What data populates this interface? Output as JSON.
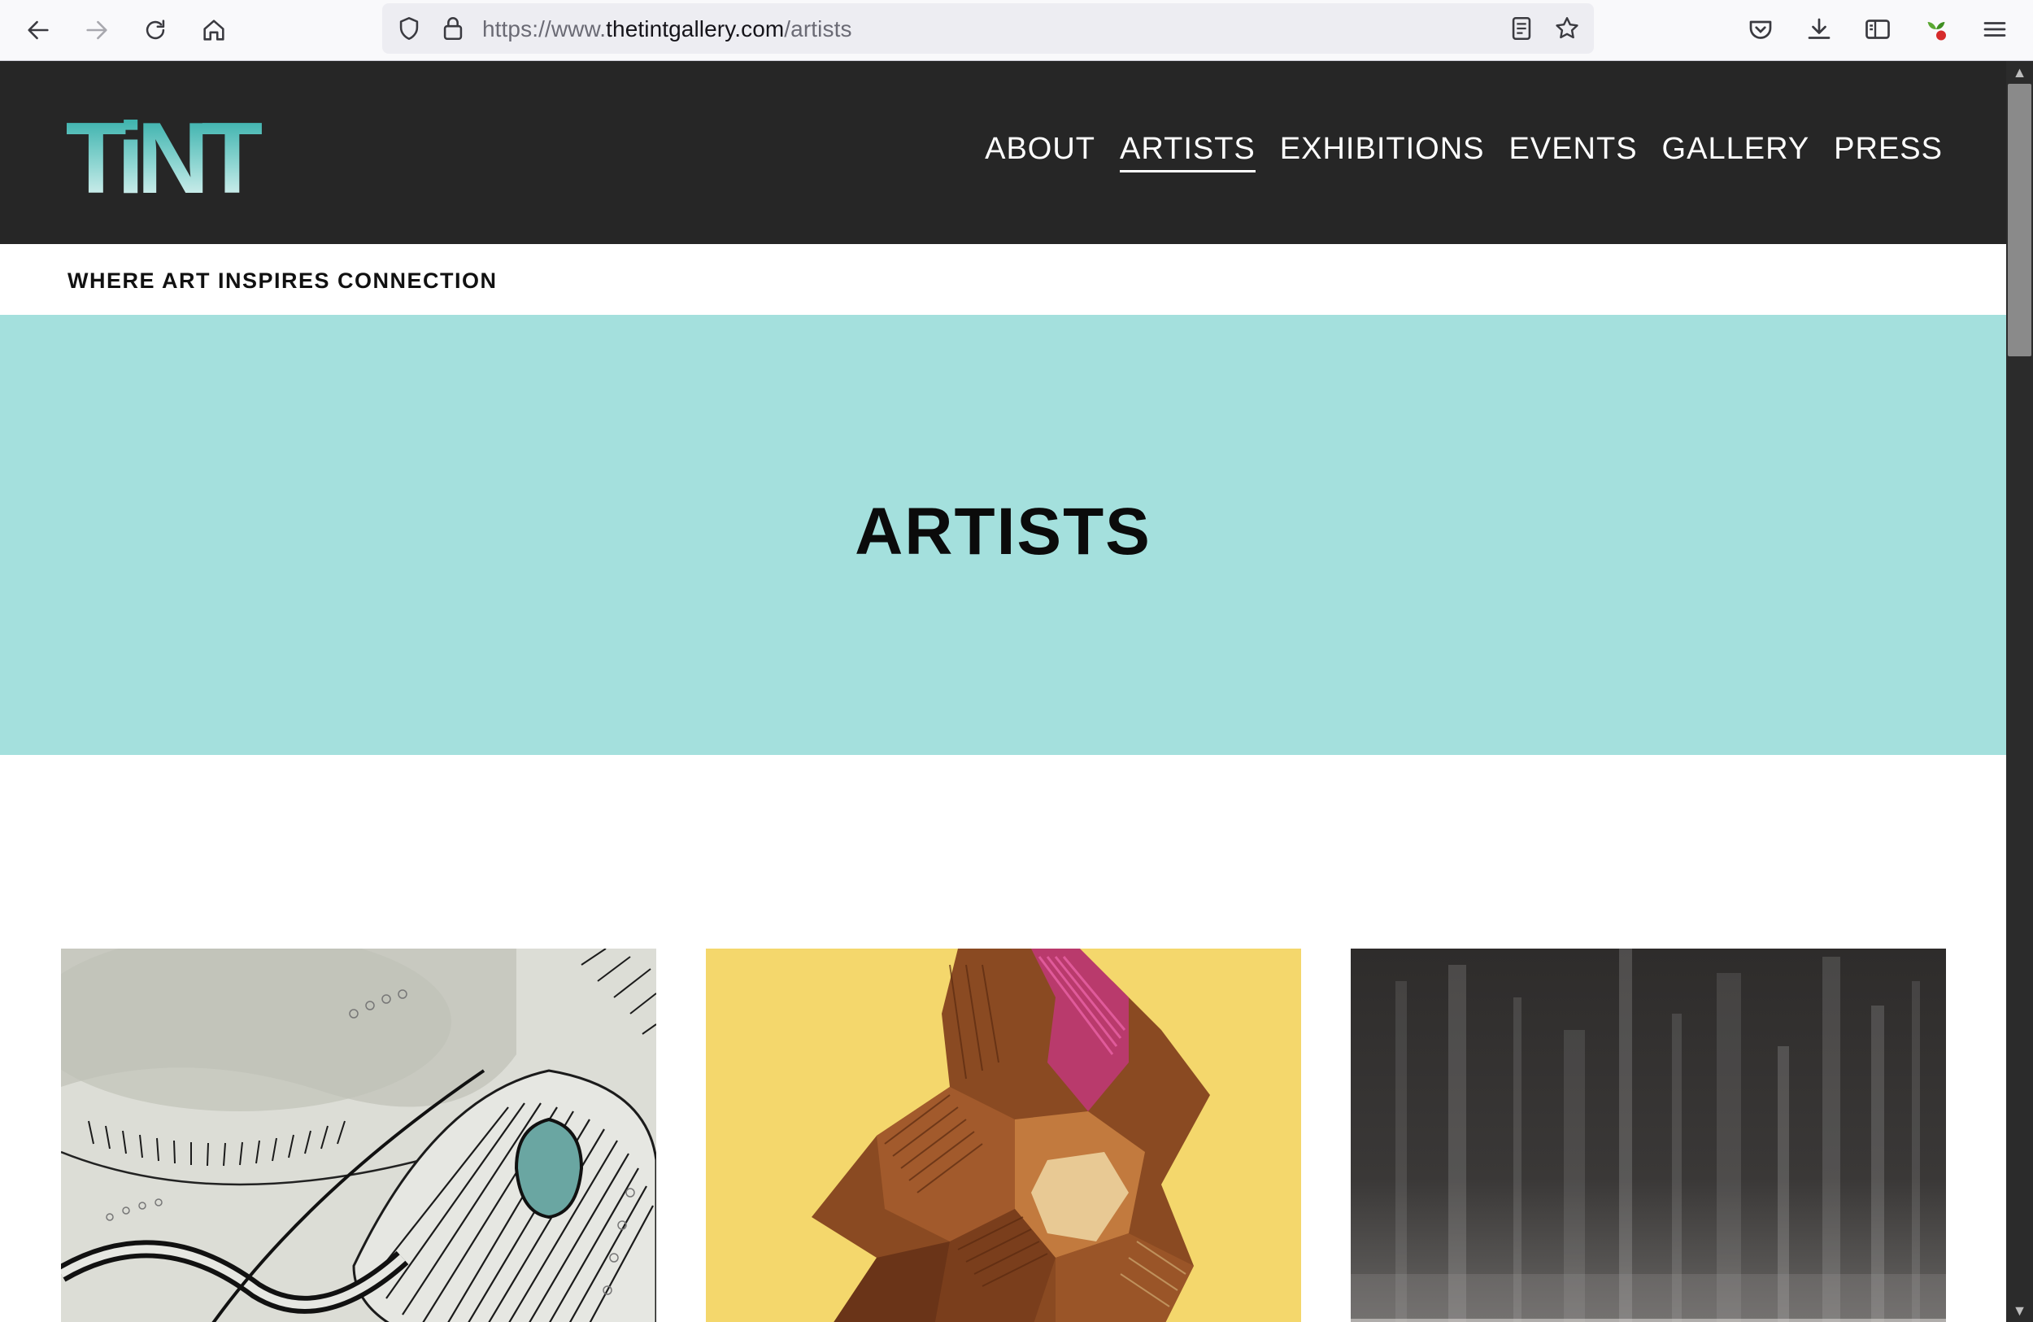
{
  "browser": {
    "url_prefix": "https://www.",
    "url_host": "thetintgallery.com",
    "url_path": "/artists",
    "icons": {
      "back": "arrow-left-icon",
      "forward": "arrow-right-icon",
      "reload": "reload-icon",
      "home": "home-icon",
      "tracking": "shield-icon",
      "lock": "lock-icon",
      "reader": "reader-view-icon",
      "bookmark": "star-icon",
      "pocket": "pocket-icon",
      "downloads": "download-icon",
      "sidebar": "sidebar-icon",
      "extension": "extension-icon",
      "menu": "hamburger-menu-icon"
    }
  },
  "site": {
    "logo_text": "TiNT",
    "nav": [
      {
        "label": "ABOUT",
        "active": false
      },
      {
        "label": "ARTISTS",
        "active": true
      },
      {
        "label": "EXHIBITIONS",
        "active": false
      },
      {
        "label": "EVENTS",
        "active": false
      },
      {
        "label": "GALLERY",
        "active": false
      },
      {
        "label": "PRESS",
        "active": false
      }
    ],
    "tagline": "WHERE ART INSPIRES CONNECTION",
    "hero_title": "ARTISTS",
    "colors": {
      "header_bg": "#262626",
      "hero_bg": "#a4e0dd",
      "logo_teal": "#1fa5a0"
    }
  }
}
